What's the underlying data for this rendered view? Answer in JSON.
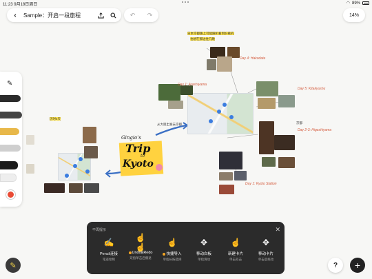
{
  "status": {
    "time": "11:23",
    "date": "9月18日周日",
    "battery": "89%"
  },
  "toolbar": {
    "back_icon": "chevron-left-icon",
    "title": "Sample：开启一段旅程",
    "share_icon": "share-icon",
    "search_icon": "search-icon",
    "undo_icon": "undo-icon",
    "redo_icon": "redo-icon",
    "zoom": "14%"
  },
  "canvas": {
    "title_sticker": {
      "author": "Gingio's",
      "line1": "Trip",
      "line2": "to",
      "line3": "Kyoto"
    },
    "day_labels": [
      "Day 4: Hakodate",
      "Day 5: Kitakyushu",
      "Day 1: Arashiyama",
      "Day 2-3: Higashiyama",
      "Day 1: Kyoto Station"
    ],
    "notes": [
      "日本京都路上可能随机看到好看的",
      "也想在那边住几晚",
      "历时4天",
      "从大阪出发去京都",
      "京都"
    ]
  },
  "tips_panel": {
    "title": "不再提示",
    "close_icon": "close-icon",
    "items": [
      {
        "icon": "pencil-touch-icon",
        "label": "Pencil连接",
        "desc": "笔迹绘制"
      },
      {
        "icon": "two-finger-tap-icon",
        "label": "Undo&Redo",
        "desc": "双指单击后撤退",
        "dot": true
      },
      {
        "icon": "three-finger-tap-icon",
        "label": "快捷导入",
        "desc": "单指长按选择",
        "dot": true
      },
      {
        "icon": "pan-icon",
        "label": "移动白板",
        "desc": "单指滑动"
      },
      {
        "icon": "tap-icon",
        "label": "新建卡片",
        "desc": "单击双击"
      },
      {
        "icon": "move-card-icon",
        "label": "移动卡片",
        "desc": "单击后拖动"
      }
    ]
  },
  "bottom": {
    "pencil_icon": "pencil-icon",
    "help_label": "?",
    "add_label": "+"
  }
}
